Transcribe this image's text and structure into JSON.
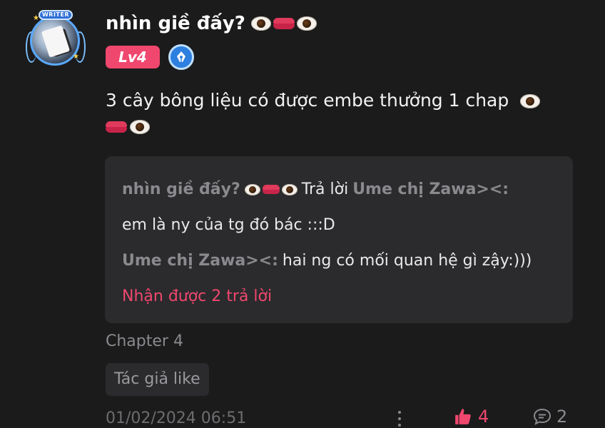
{
  "user": {
    "name": "nhìn giề đấy?",
    "avatar_badge": "WRITER",
    "level": "Lv4",
    "name_emojis": [
      "eye",
      "lips",
      "eye"
    ]
  },
  "comment": {
    "text": "3 cây bông liệu có được embe thưởng 1 chap",
    "trailing_emojis": [
      "eye",
      "lips",
      "eye"
    ]
  },
  "reply_preview": {
    "author": "nhìn giề đấy?",
    "reply_to_label": "Trả lời",
    "reply_to_user": "Ume chị Zawa><:",
    "reply_text": "em là ny của tg đó bác :::D",
    "quoted_author": "Ume chị Zawa><:",
    "quoted_text": "hai ng có mối quan hệ gì zậy:)))",
    "more_replies": "Nhận được 2 trả lời"
  },
  "meta": {
    "chapter": "Chapter 4",
    "tag": "Tác giả like",
    "date": "01/02/2024 06:51",
    "likes": "4",
    "replies": "2"
  },
  "colors": {
    "background": "#1b1b1c",
    "accent": "#f0476e",
    "panel": "#2b2b2d",
    "muted": "#8a8a8e"
  }
}
